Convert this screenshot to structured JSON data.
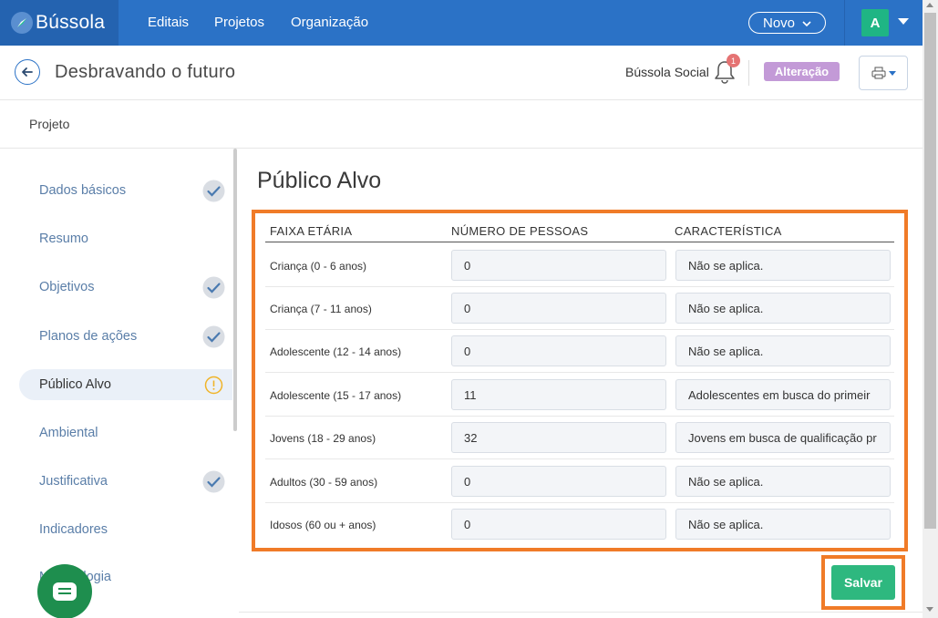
{
  "nav": {
    "brand": "Bússola",
    "links": [
      "Editais",
      "Projetos",
      "Organização"
    ],
    "novo_label": "Novo",
    "avatar_initial": "A",
    "color": "#2b72c6"
  },
  "header": {
    "title": "Desbravando o futuro",
    "org_name": "Bússola Social",
    "notification_count": "1",
    "status_badge": "Alteração"
  },
  "breadcrumb": "Projeto",
  "sidebar": {
    "items": [
      {
        "label": "Dados básicos",
        "status": "check-icon"
      },
      {
        "label": "Resumo",
        "status": ""
      },
      {
        "label": "Objetivos",
        "status": "check-icon"
      },
      {
        "label": "Planos de ações",
        "status": "check-icon"
      },
      {
        "label": "Público Alvo",
        "status": "warning-icon",
        "active": true
      },
      {
        "label": "Ambiental",
        "status": ""
      },
      {
        "label": "Justificativa",
        "status": "check-icon"
      },
      {
        "label": "Indicadores",
        "status": ""
      },
      {
        "label": "Metodologia",
        "status": ""
      }
    ]
  },
  "main": {
    "section_title": "Público Alvo",
    "columns": [
      "FAIXA ETÁRIA",
      "NÚMERO DE PESSOAS",
      "CARACTERÍSTICA"
    ],
    "rows": [
      {
        "faixa": "Criança (0 - 6 anos)",
        "numero": "0",
        "caracteristica": "Não se aplica."
      },
      {
        "faixa": "Criança (7 - 11 anos)",
        "numero": "0",
        "caracteristica": "Não se aplica."
      },
      {
        "faixa": "Adolescente (12 - 14 anos)",
        "numero": "0",
        "caracteristica": "Não se aplica."
      },
      {
        "faixa": "Adolescente (15 - 17 anos)",
        "numero": "11",
        "caracteristica": "Adolescentes em busca do primeir"
      },
      {
        "faixa": "Jovens (18 - 29 anos)",
        "numero": "32",
        "caracteristica": "Jovens em busca de qualificação pr"
      },
      {
        "faixa": "Adultos (30 - 59 anos)",
        "numero": "0",
        "caracteristica": "Não se aplica."
      },
      {
        "faixa": "Idosos (60 ou + anos)",
        "numero": "0",
        "caracteristica": "Não se aplica."
      }
    ],
    "save_label": "Salvar",
    "accent": "#f07b28",
    "save_color": "#2eb87f"
  }
}
